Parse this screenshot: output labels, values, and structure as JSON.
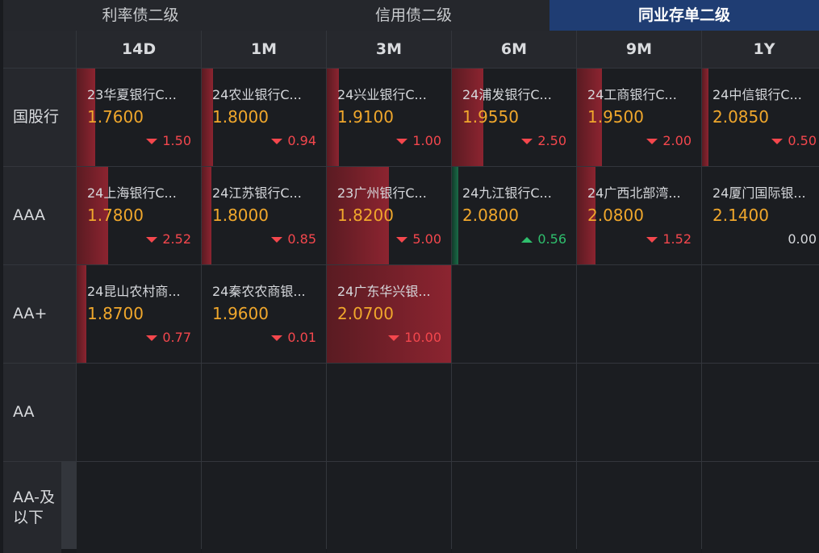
{
  "tabs": [
    {
      "label": "利率债二级",
      "active": false
    },
    {
      "label": "信用债二级",
      "active": false
    },
    {
      "label": "同业存单二级",
      "active": true
    }
  ],
  "columns": [
    "14D",
    "1M",
    "3M",
    "6M",
    "9M",
    "1Y"
  ],
  "rows": [
    {
      "label": "国股行",
      "cells": [
        {
          "name": "23华夏银行C...",
          "yield": "1.7600",
          "change": "1.50",
          "direction": "down",
          "bar_fraction": 0.15
        },
        {
          "name": "24农业银行C...",
          "yield": "1.8000",
          "change": "0.94",
          "direction": "down",
          "bar_fraction": 0.09
        },
        {
          "name": "24兴业银行C...",
          "yield": "1.9100",
          "change": "1.00",
          "direction": "down",
          "bar_fraction": 0.1
        },
        {
          "name": "24浦发银行C...",
          "yield": "1.9550",
          "change": "2.50",
          "direction": "down",
          "bar_fraction": 0.25
        },
        {
          "name": "24工商银行C...",
          "yield": "1.9500",
          "change": "2.00",
          "direction": "down",
          "bar_fraction": 0.2
        },
        {
          "name": "24中信银行C...",
          "yield": "2.0850",
          "change": "0.50",
          "direction": "down",
          "bar_fraction": 0.05
        }
      ]
    },
    {
      "label": "AAA",
      "cells": [
        {
          "name": "24上海银行C...",
          "yield": "1.7800",
          "change": "2.52",
          "direction": "down",
          "bar_fraction": 0.25
        },
        {
          "name": "24江苏银行C...",
          "yield": "1.8000",
          "change": "0.85",
          "direction": "down",
          "bar_fraction": 0.08
        },
        {
          "name": "23广州银行C...",
          "yield": "1.8200",
          "change": "5.00",
          "direction": "down",
          "bar_fraction": 0.5
        },
        {
          "name": "24九江银行C...",
          "yield": "2.0800",
          "change": "0.56",
          "direction": "up",
          "bar_fraction": 0.05
        },
        {
          "name": "24广西北部湾...",
          "yield": "2.0800",
          "change": "1.52",
          "direction": "down",
          "bar_fraction": 0.15
        },
        {
          "name": "24厦门国际银...",
          "yield": "2.1400",
          "change": "0.00",
          "direction": "flat",
          "bar_fraction": 0
        }
      ]
    },
    {
      "label": "AA+",
      "cells": [
        {
          "name": "24昆山农村商...",
          "yield": "1.8700",
          "change": "0.77",
          "direction": "down",
          "bar_fraction": 0.08
        },
        {
          "name": "24秦农农商银...",
          "yield": "1.9600",
          "change": "0.01",
          "direction": "down",
          "bar_fraction": 0.0
        },
        {
          "name": "24广东华兴银...",
          "yield": "2.0700",
          "change": "10.00",
          "direction": "down",
          "bar_fraction": 1.0
        },
        null,
        null,
        null
      ]
    },
    {
      "label": "AA",
      "cells": [
        null,
        null,
        null,
        null,
        null,
        null
      ]
    },
    {
      "label": "AA-及以下",
      "cells": [
        null,
        null,
        null,
        null,
        null,
        null
      ]
    }
  ]
}
